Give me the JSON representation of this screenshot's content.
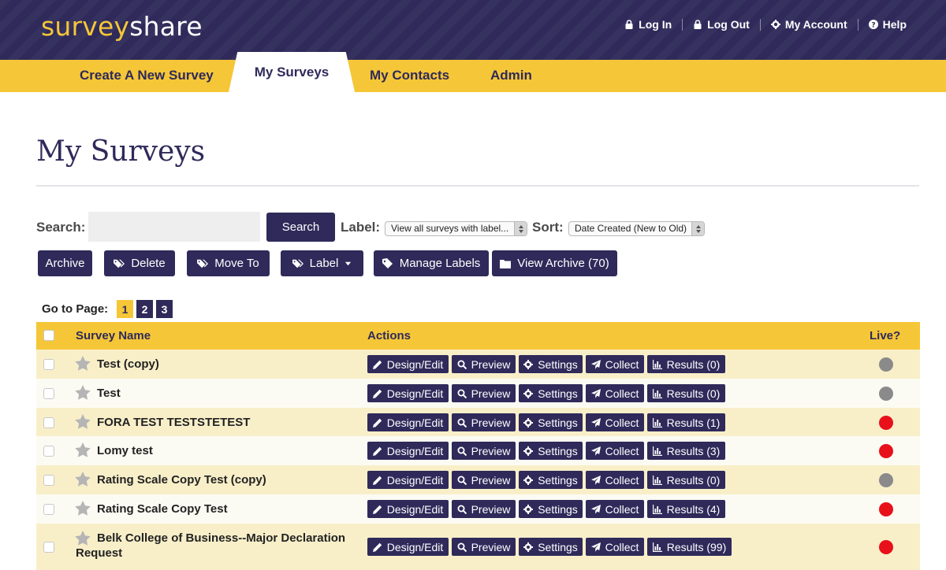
{
  "header": {
    "logo_part1": "survey",
    "logo_part2": "share",
    "links": {
      "login": "Log In",
      "logout": "Log Out",
      "account": "My Account",
      "help": "Help"
    }
  },
  "nav": {
    "create": "Create A New Survey",
    "surveys": "My Surveys",
    "contacts": "My Contacts",
    "admin": "Admin"
  },
  "page": {
    "title": "My Surveys"
  },
  "toolbar": {
    "search_label": "Search:",
    "search_value": "",
    "search_button": "Search",
    "label_label": "Label:",
    "label_select": "View all surveys with label...",
    "sort_label": "Sort:",
    "sort_select": "Date Created (New to Old)",
    "archive": "Archive",
    "delete": "Delete",
    "move_to": "Move To",
    "label": "Label",
    "manage_labels": "Manage Labels",
    "view_archive": "View Archive (70)"
  },
  "pagination": {
    "label": "Go to Page:",
    "pages": [
      "1",
      "2",
      "3"
    ]
  },
  "table": {
    "headers": {
      "name": "Survey Name",
      "actions": "Actions",
      "live": "Live?"
    },
    "action_labels": {
      "design": "Design/Edit",
      "preview": "Preview",
      "settings": "Settings",
      "collect": "Collect"
    },
    "rows": [
      {
        "name": "Test (copy)",
        "results": "Results (0)",
        "live": false
      },
      {
        "name": "Test",
        "results": "Results (0)",
        "live": false
      },
      {
        "name": "FORA TEST TESTSTETEST",
        "results": "Results (1)",
        "live": true
      },
      {
        "name": "Lomy test",
        "results": "Results (3)",
        "live": true
      },
      {
        "name": "Rating Scale Copy Test (copy)",
        "results": "Results (0)",
        "live": false
      },
      {
        "name": "Rating Scale Copy Test",
        "results": "Results (4)",
        "live": true
      },
      {
        "name": "Belk College of Business--Major Declaration Request",
        "results": "Results (99)",
        "live": true
      }
    ]
  },
  "colors": {
    "brand_purple": "#2f2a5a",
    "brand_yellow": "#f5c637",
    "live_on": "#e8101a",
    "live_off": "#8a8a8a"
  }
}
